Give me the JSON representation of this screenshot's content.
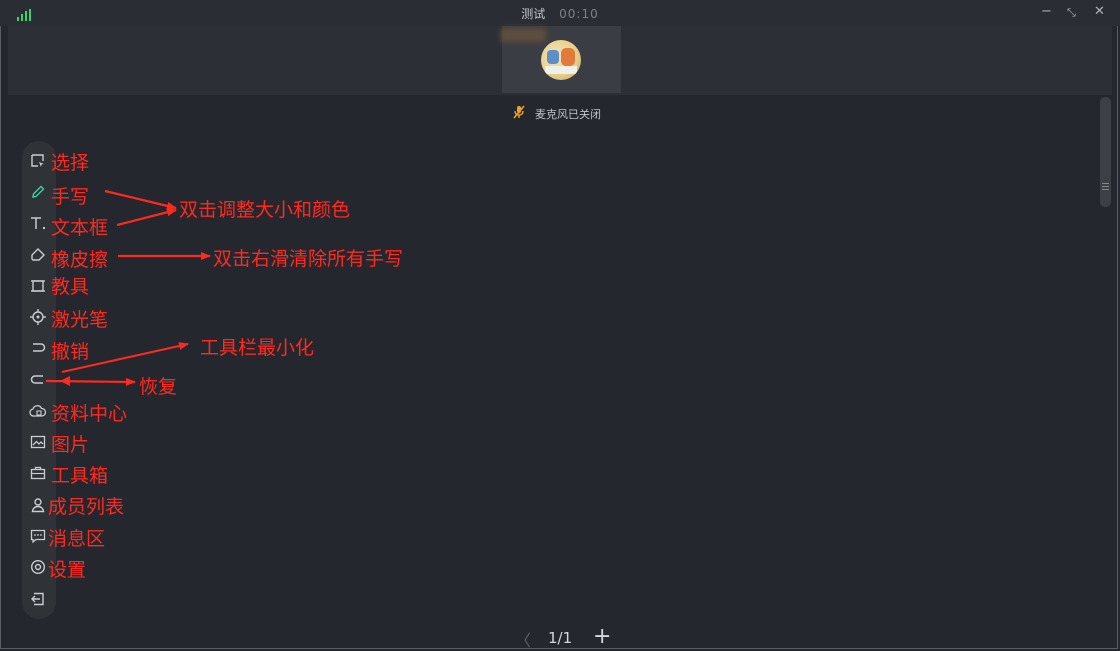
{
  "window": {
    "title": "测试",
    "timer": "00:10",
    "controls": [
      "−",
      "⤡",
      "✕"
    ]
  },
  "status": {
    "mic": "麦克风已关闭"
  },
  "toolbar": {
    "items": [
      {
        "label": "选择",
        "icon": "select-icon"
      },
      {
        "label": "手写",
        "icon": "pen-icon",
        "active": true
      },
      {
        "label": "文本框",
        "icon": "text-icon"
      },
      {
        "label": "橡皮擦",
        "icon": "eraser-icon"
      },
      {
        "label": "教具",
        "icon": "ruler-icon"
      },
      {
        "label": "激光笔",
        "icon": "laser-icon"
      },
      {
        "label": "撤销",
        "icon": "undo-icon"
      },
      {
        "label": "恢复",
        "icon": "redo-icon"
      },
      {
        "label": "资料中心",
        "icon": "cloud-icon"
      },
      {
        "label": "图片",
        "icon": "image-icon"
      },
      {
        "label": "工具箱",
        "icon": "toolbox-icon"
      },
      {
        "label": "成员列表",
        "icon": "member-icon"
      },
      {
        "label": "消息区",
        "icon": "message-icon"
      },
      {
        "label": "设置",
        "icon": "settings-icon"
      },
      {
        "label": "",
        "icon": "exit-icon"
      }
    ]
  },
  "annotations": {
    "resize_color": "双击调整大小和颜色",
    "swipe_clear": "双击右滑清除所有手写",
    "minimize": "工具栏最小化"
  },
  "pager": {
    "page": "1/1"
  },
  "colors": {
    "annotation": "#ff2a1f",
    "active_tool": "#3fd0a8",
    "mic_icon": "#f0a21e"
  }
}
